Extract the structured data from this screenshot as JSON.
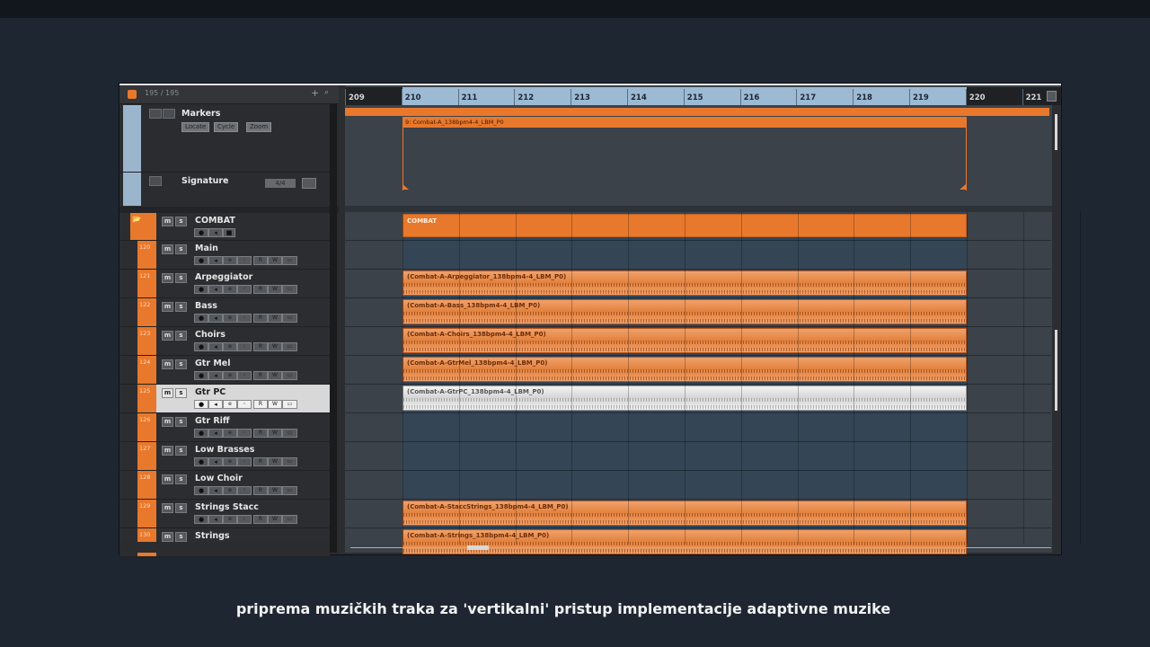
{
  "header": {
    "count": "195 / 195",
    "add_icon": "plus-icon",
    "find_icon": "search-icon"
  },
  "markers_track": {
    "label": "Markers",
    "buttons": [
      "Locate",
      "Cycle",
      "Zoom"
    ]
  },
  "signature_track": {
    "label": "Signature",
    "value": "4/4"
  },
  "ruler": {
    "bars": [
      "209",
      "210",
      "211",
      "212",
      "213",
      "214",
      "215",
      "216",
      "217",
      "218",
      "219",
      "220",
      "221"
    ]
  },
  "marker_event": {
    "label": "9: Combat-A_138bpm4-4_LBM_P0"
  },
  "tracks": [
    {
      "name": "COMBAT",
      "num": "",
      "folder": true,
      "clip": "COMBAT"
    },
    {
      "name": "Main",
      "num": "120",
      "clip": ""
    },
    {
      "name": "Arpeggiator",
      "num": "121",
      "clip": "(Combat-A-Arpeggiator_138bpm4-4_LBM_P0)"
    },
    {
      "name": "Bass",
      "num": "122",
      "clip": "(Combat-A-Bass_138bpm4-4_LBM_P0)"
    },
    {
      "name": "Choirs",
      "num": "123",
      "clip": "(Combat-A-Choirs_138bpm4-4_LBM_P0)"
    },
    {
      "name": "Gtr Mel",
      "num": "124",
      "clip": "(Combat-A-GtrMel_138bpm4-4_LBM_P0)"
    },
    {
      "name": "Gtr PC",
      "num": "125",
      "selected": true,
      "clip": "(Combat-A-GtrPC_138bpm4-4_LBM_P0)"
    },
    {
      "name": "Gtr Riff",
      "num": "126",
      "clip": ""
    },
    {
      "name": "Low Brasses",
      "num": "127",
      "clip": ""
    },
    {
      "name": "Low Choir",
      "num": "128",
      "clip": ""
    },
    {
      "name": "Strings Stacc",
      "num": "129",
      "clip": "(Combat-A-StaccStrings_138bpm4-4_LBM_P0)"
    },
    {
      "name": "Strings",
      "num": "130",
      "clip": "(Combat-A-Strings_138bpm4-4_LBM_P0)"
    }
  ],
  "colors": {
    "accent": "#e8782c",
    "loop": "#9cbad4",
    "background": "#1e2632"
  },
  "caption": "priprema muzičkih traka za 'vertikalni' pristup implementacije adaptivne muzike"
}
